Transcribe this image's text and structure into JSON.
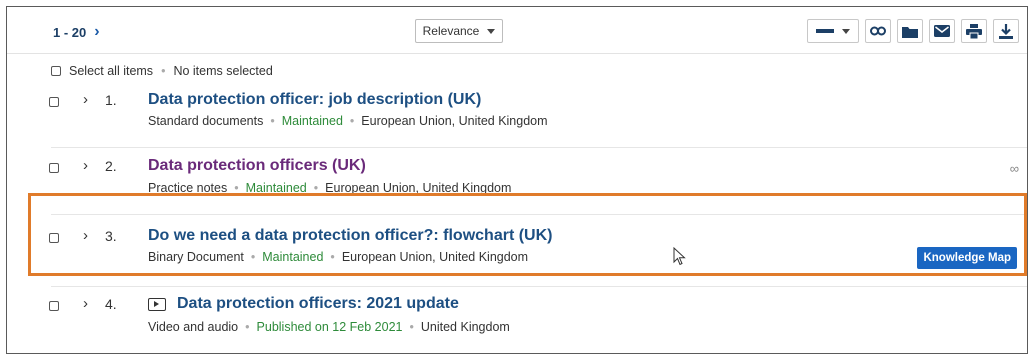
{
  "toolbar": {
    "range": "1 - 20",
    "sort_label": "Relevance",
    "icons": [
      "dash-icon",
      "link-icon",
      "folder-icon",
      "mail-icon",
      "print-icon",
      "download-icon"
    ]
  },
  "selection": {
    "select_all_label": "Select all items",
    "status": "No items selected"
  },
  "results": [
    {
      "number": "1.",
      "title": "Data protection officer: job description (UK)",
      "type": "Standard documents",
      "status": "Maintained",
      "jurisdiction": "European Union, United Kingdom"
    },
    {
      "number": "2.",
      "title": "Data protection officers (UK)",
      "type": "Practice notes",
      "status": "Maintained",
      "jurisdiction": "European Union, United Kingdom"
    },
    {
      "number": "3.",
      "title": "Do we need a data protection officer?: flowchart (UK)",
      "type": "Binary Document",
      "status": "Maintained",
      "jurisdiction": "European Union, United Kingdom",
      "action_label": "Knowledge Map"
    },
    {
      "number": "4.",
      "title": "Data protection officers: 2021 update",
      "type": "Video and audio",
      "status": "Published on 12 Feb 2021",
      "jurisdiction": "United Kingdom"
    }
  ],
  "colors": {
    "link": "#1d4f82",
    "visited": "#6a2a7a",
    "status_green": "#2e8b3a",
    "accent_button": "#1a66c2",
    "highlight": "#e07b2a"
  }
}
